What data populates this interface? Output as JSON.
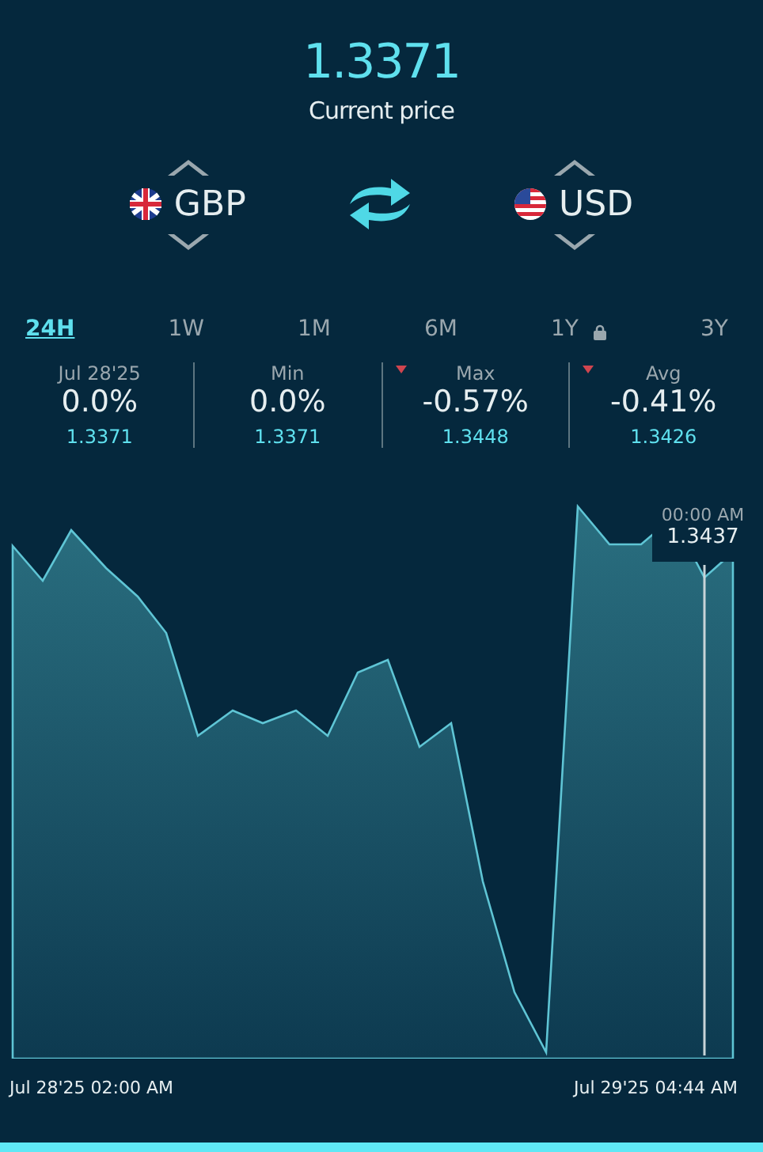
{
  "price": {
    "value": "1.3371",
    "label": "Current price"
  },
  "pair": {
    "base": "GBP",
    "quote": "USD"
  },
  "tabs": [
    {
      "label": "24H",
      "selected": true,
      "locked": false
    },
    {
      "label": "1W",
      "selected": false,
      "locked": false
    },
    {
      "label": "1M",
      "selected": false,
      "locked": false
    },
    {
      "label": "6M",
      "selected": false,
      "locked": false
    },
    {
      "label": "1Y",
      "selected": false,
      "locked": true
    },
    {
      "label": "3Y",
      "selected": false,
      "locked": false
    }
  ],
  "stats": [
    {
      "label": "Jul 28'25",
      "change": "0.0%",
      "rate": "1.3371",
      "down": false
    },
    {
      "label": "Min",
      "change": "0.0%",
      "rate": "1.3371",
      "down": false
    },
    {
      "label": "Max",
      "change": "-0.57%",
      "rate": "1.3448",
      "down": true
    },
    {
      "label": "Avg",
      "change": "-0.41%",
      "rate": "1.3426",
      "down": true
    }
  ],
  "tooltip": {
    "time": "00:00 AM",
    "value": "1.3437"
  },
  "axis": {
    "start": "Jul 28'25 02:00 AM",
    "end": "Jul 29'25 04:44 AM"
  }
}
